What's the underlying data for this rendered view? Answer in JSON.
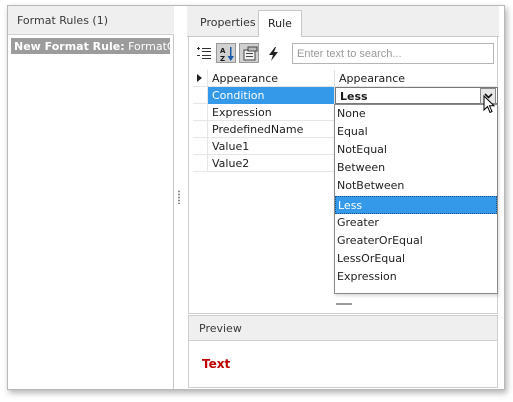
{
  "left_panel": {
    "title": "Format Rules (1)",
    "rule_name": "New Format Rule:",
    "rule_type": " FormatCor"
  },
  "tabs": [
    {
      "label": "Properties",
      "active": false
    },
    {
      "label": "Rule",
      "active": true
    }
  ],
  "toolbar": {
    "icons": [
      "categorized-icon",
      "alphabetical-sort-icon",
      "property-pages-icon",
      "events-icon"
    ],
    "search_placeholder": "Enter text to search..."
  },
  "property_grid": {
    "rows": [
      {
        "name": "Appearance",
        "value": "Appearance",
        "expandable": true
      },
      {
        "name": "Condition",
        "value": "Less",
        "selected": true
      },
      {
        "name": "Expression",
        "value": ""
      },
      {
        "name": "PredefinedName",
        "value": ""
      },
      {
        "name": "Value1",
        "value": ""
      },
      {
        "name": "Value2",
        "value": ""
      }
    ]
  },
  "dropdown": {
    "options": [
      "None",
      "Equal",
      "NotEqual",
      "Between",
      "NotBetween",
      "Less",
      "Greater",
      "GreaterOrEqual",
      "LessOrEqual",
      "Expression"
    ],
    "selected": "Less"
  },
  "preview": {
    "title": "Preview",
    "sample_text": "Text"
  },
  "colors": {
    "selection": "#3399e8",
    "preview_text": "#c00000",
    "header_bg": "#efefef"
  }
}
